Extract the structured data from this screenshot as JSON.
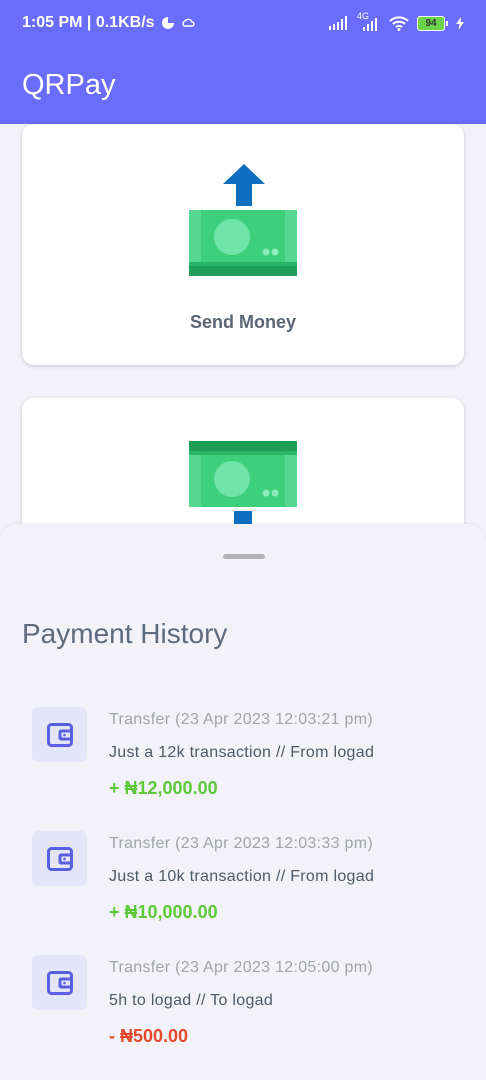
{
  "status_bar": {
    "time_speed": "1:05 PM | 0.1KB/s",
    "network": "4G",
    "battery": "94"
  },
  "app": {
    "title": "QRPay"
  },
  "cards": {
    "send_label": "Send Money"
  },
  "history": {
    "title": "Payment History",
    "items": [
      {
        "meta": "Transfer (23 Apr 2023 12:03:21 pm)",
        "description": "Just a 12k transaction // From logad",
        "amount": "+ ₦12,000.00"
      },
      {
        "meta": "Transfer (23 Apr 2023 12:03:33 pm)",
        "description": "Just a 10k transaction // From logad",
        "amount": "+ ₦10,000.00"
      },
      {
        "meta": "Transfer (23 Apr 2023 12:05:00 pm)",
        "description": "5h to logad // To logad",
        "amount": "- ₦500.00"
      }
    ]
  },
  "colors": {
    "primary": "#6a6cfb",
    "credit": "#5cc93b",
    "debit": "#e5482a",
    "money_green": "#3ecf7d",
    "arrow_blue": "#0d6ebf"
  },
  "icons": [
    "wallet-icon",
    "up-arrow-icon",
    "cash-icon",
    "wifi-icon",
    "signal-icon",
    "battery-icon"
  ]
}
